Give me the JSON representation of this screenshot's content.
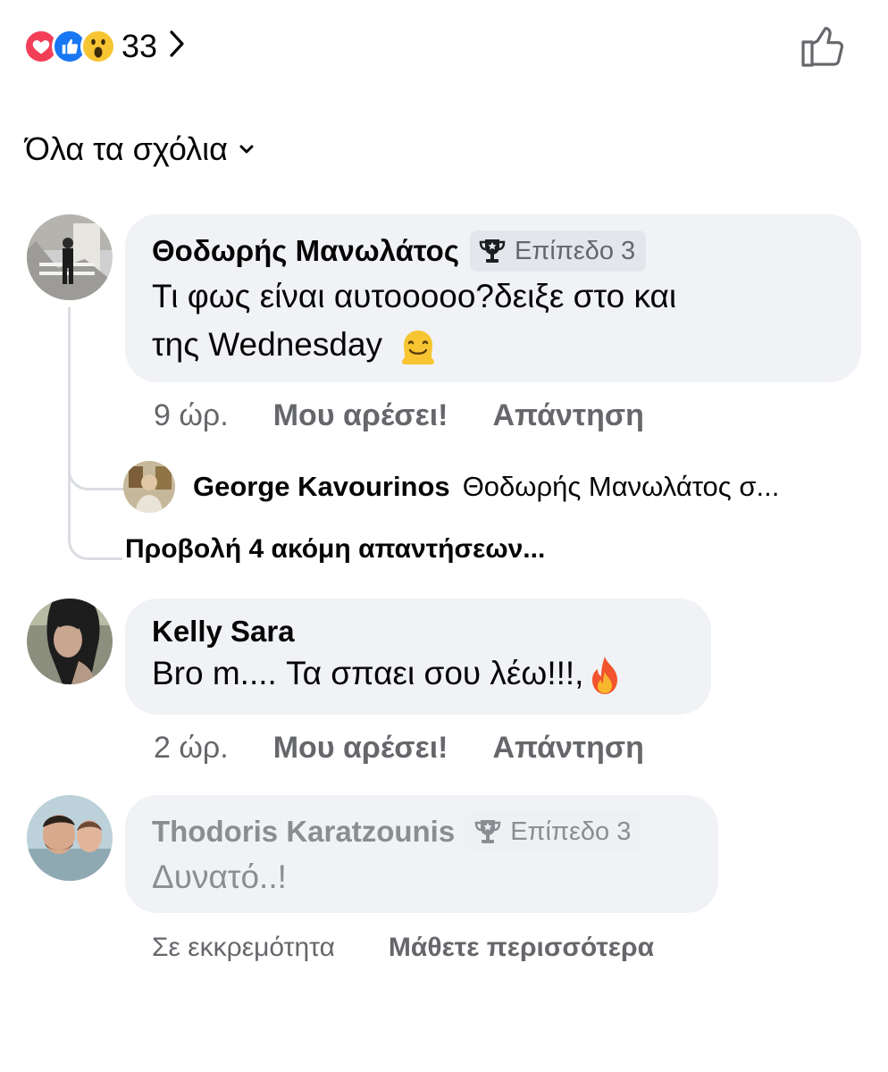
{
  "reactions": {
    "count": "33",
    "icons": [
      "love-icon",
      "like-icon",
      "wow-icon"
    ],
    "colors": {
      "love": "#f33e58",
      "like": "#1877f2",
      "wow": "#f7c531"
    }
  },
  "filter": {
    "label": "Όλα τα σχόλια"
  },
  "comments": [
    {
      "author": "Θοδωρής Μανωλάτος",
      "badge": "Επίπεδο 3",
      "text_line1": "Τι φως είναι αυτοοοοο?δειξε στο και",
      "text_line2": "της Wednesday",
      "emoji": "melting-face-icon",
      "time": "9 ώρ.",
      "like": "Μου αρέσει!",
      "reply": "Απάντηση",
      "replies": {
        "first_author": "George Kavourinos",
        "first_snippet": "Θοδωρής Μανωλάτος σ...",
        "more_label": "Προβολή 4 ακόμη απαντήσεων..."
      }
    },
    {
      "author": "Kelly Sara",
      "text": "Bro m.... Τα σπαει σου λέω!!!,",
      "emoji": "fire-icon",
      "time": "2 ώρ.",
      "like": "Μου αρέσει!",
      "reply": "Απάντηση"
    },
    {
      "author": "Thodoris Karatzounis",
      "badge": "Επίπεδο 3",
      "text": "Δυνατό..!",
      "status": "Σε εκκρεμότητα",
      "learn_more": "Μάθετε περισσότερα"
    }
  ]
}
